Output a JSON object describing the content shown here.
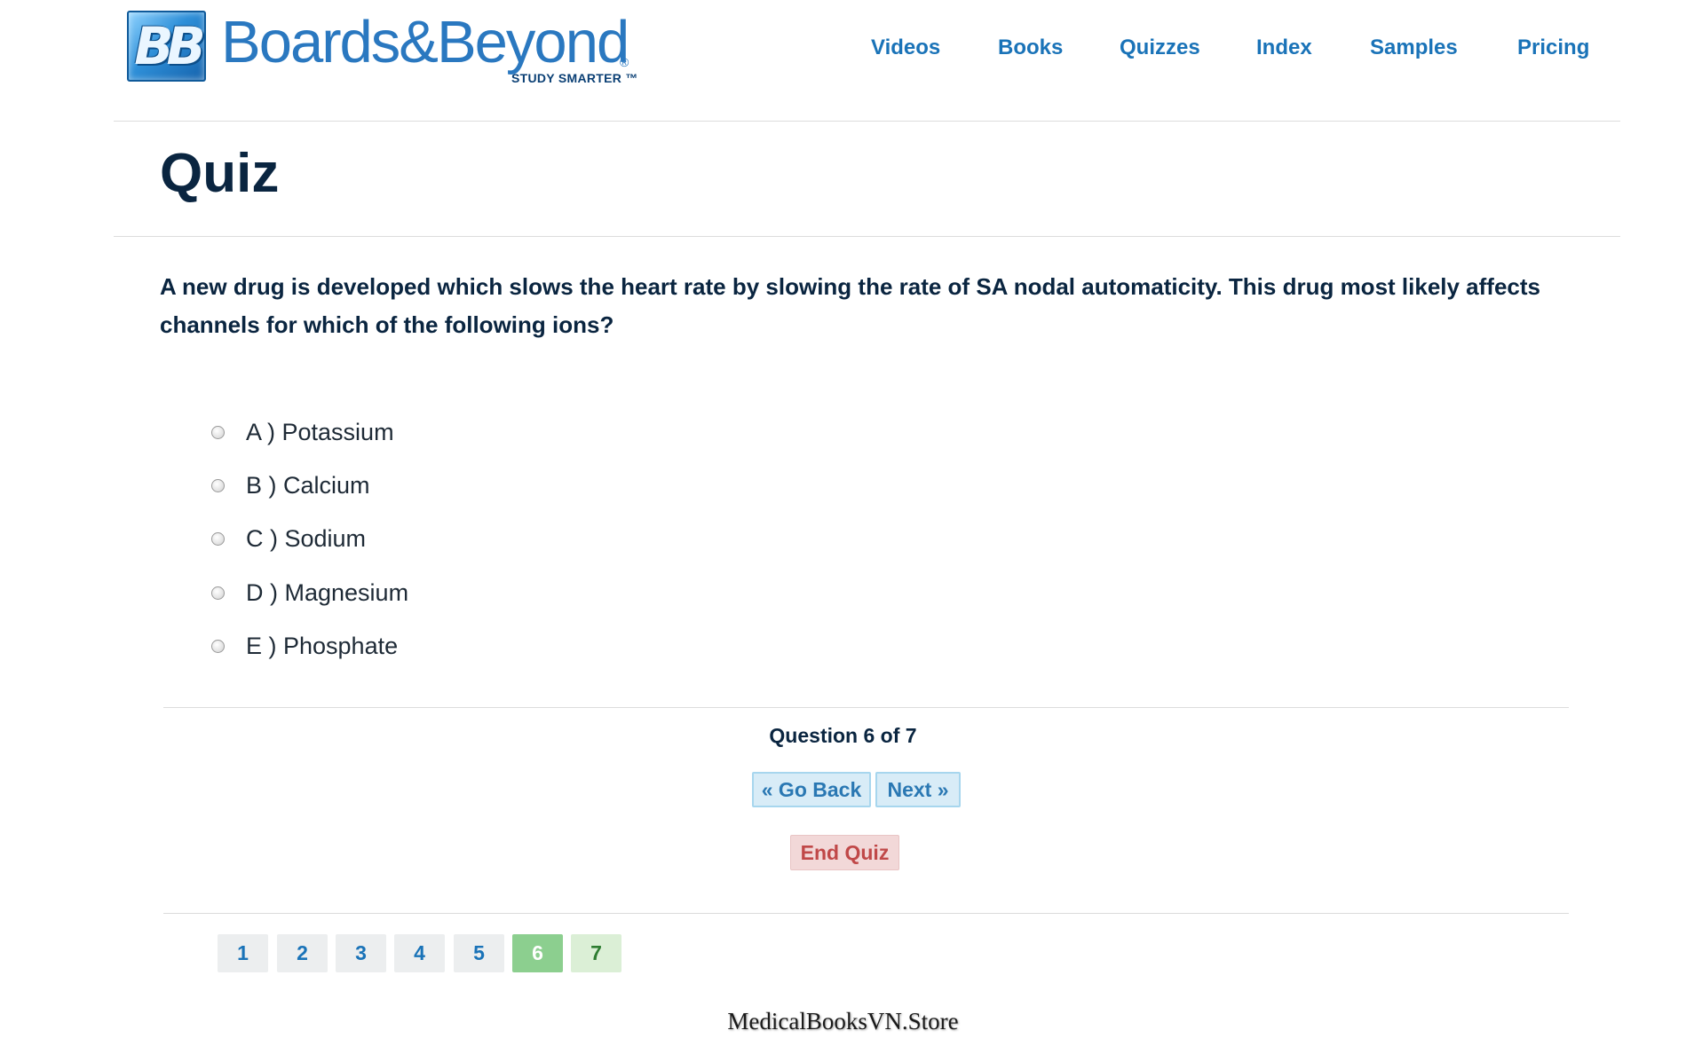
{
  "header": {
    "logo_badge": "BB",
    "logo_name": "Boards&Beyond",
    "logo_reg": "®",
    "logo_tagline": "STUDY SMARTER ™",
    "nav": [
      "Videos",
      "Books",
      "Quizzes",
      "Index",
      "Samples",
      "Pricing"
    ]
  },
  "page_title": "Quiz",
  "question": {
    "text": "A new drug is developed which slows the heart rate by slowing the rate of SA nodal automaticity. This drug most likely affects channels for which of the following ions?",
    "options": [
      "A ) Potassium",
      "B ) Calcium",
      "C ) Sodium",
      "D ) Magnesium",
      "E ) Phosphate"
    ]
  },
  "status": "Question 6 of 7",
  "controls": {
    "go_back": "« Go Back",
    "next": "Next »",
    "end_quiz": "End Quiz"
  },
  "pager": {
    "pages": [
      "1",
      "2",
      "3",
      "4",
      "5",
      "6",
      "7"
    ],
    "current": "6"
  },
  "watermark": "MedicalBooksVN.Store",
  "colors": {
    "link": "#1a73b8",
    "heading": "#0a2540",
    "nav_button_bg": "#d8ecf7",
    "end_button_bg": "#f2d8d8",
    "current_page_bg": "#8ccf8f"
  }
}
